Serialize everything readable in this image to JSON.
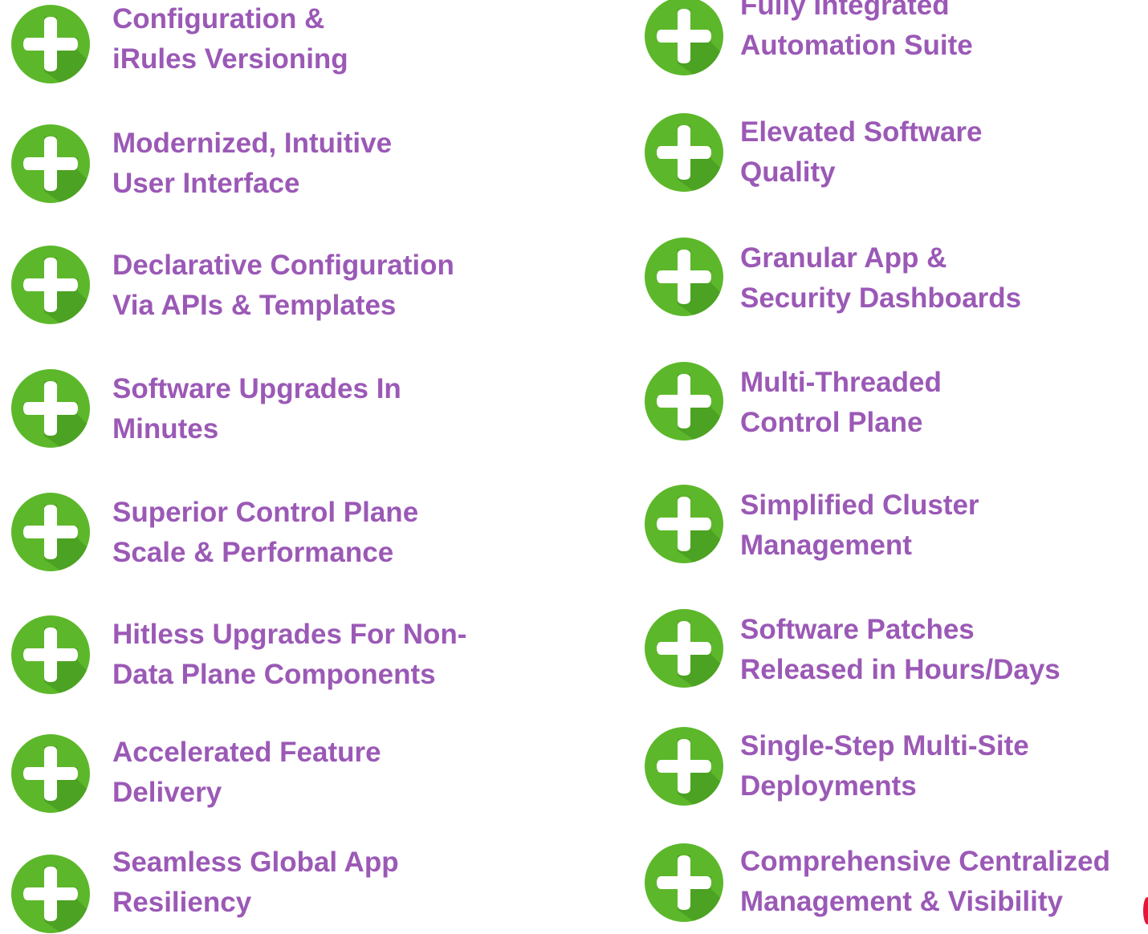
{
  "colors": {
    "text": "#9b59b6",
    "icon_circle": "#5cb82a",
    "icon_shadow": "#3f8f1c",
    "icon_plus": "#ffffff",
    "corner_mark": "#e3173a"
  },
  "icon_name": "plus-circle-icon",
  "left_column": [
    {
      "line1": "Configuration &",
      "line2": "iRules Versioning"
    },
    {
      "line1": "Modernized, Intuitive",
      "line2": "User Interface"
    },
    {
      "line1": "Declarative Configuration",
      "line2": "Via APIs & Templates"
    },
    {
      "line1": "Software Upgrades In",
      "line2": "Minutes"
    },
    {
      "line1": "Superior Control Plane",
      "line2": "Scale & Performance"
    },
    {
      "line1": "Hitless Upgrades For Non-",
      "line2": "Data Plane Components"
    },
    {
      "line1": "Accelerated Feature",
      "line2": "Delivery"
    },
    {
      "line1": "Seamless Global App",
      "line2": "Resiliency"
    }
  ],
  "right_column": [
    {
      "line1": "Fully Integrated",
      "line2": "Automation Suite"
    },
    {
      "line1": "Elevated Software",
      "line2": "Quality"
    },
    {
      "line1": "Granular App &",
      "line2": "Security Dashboards"
    },
    {
      "line1": "Multi-Threaded",
      "line2": "Control Plane"
    },
    {
      "line1": "Simplified Cluster",
      "line2": "Management"
    },
    {
      "line1": "Software Patches",
      "line2": "Released in Hours/Days"
    },
    {
      "line1": "Single-Step Multi-Site",
      "line2": "Deployments"
    },
    {
      "line1": "Comprehensive Centralized",
      "line2": "Management & Visibility"
    }
  ]
}
